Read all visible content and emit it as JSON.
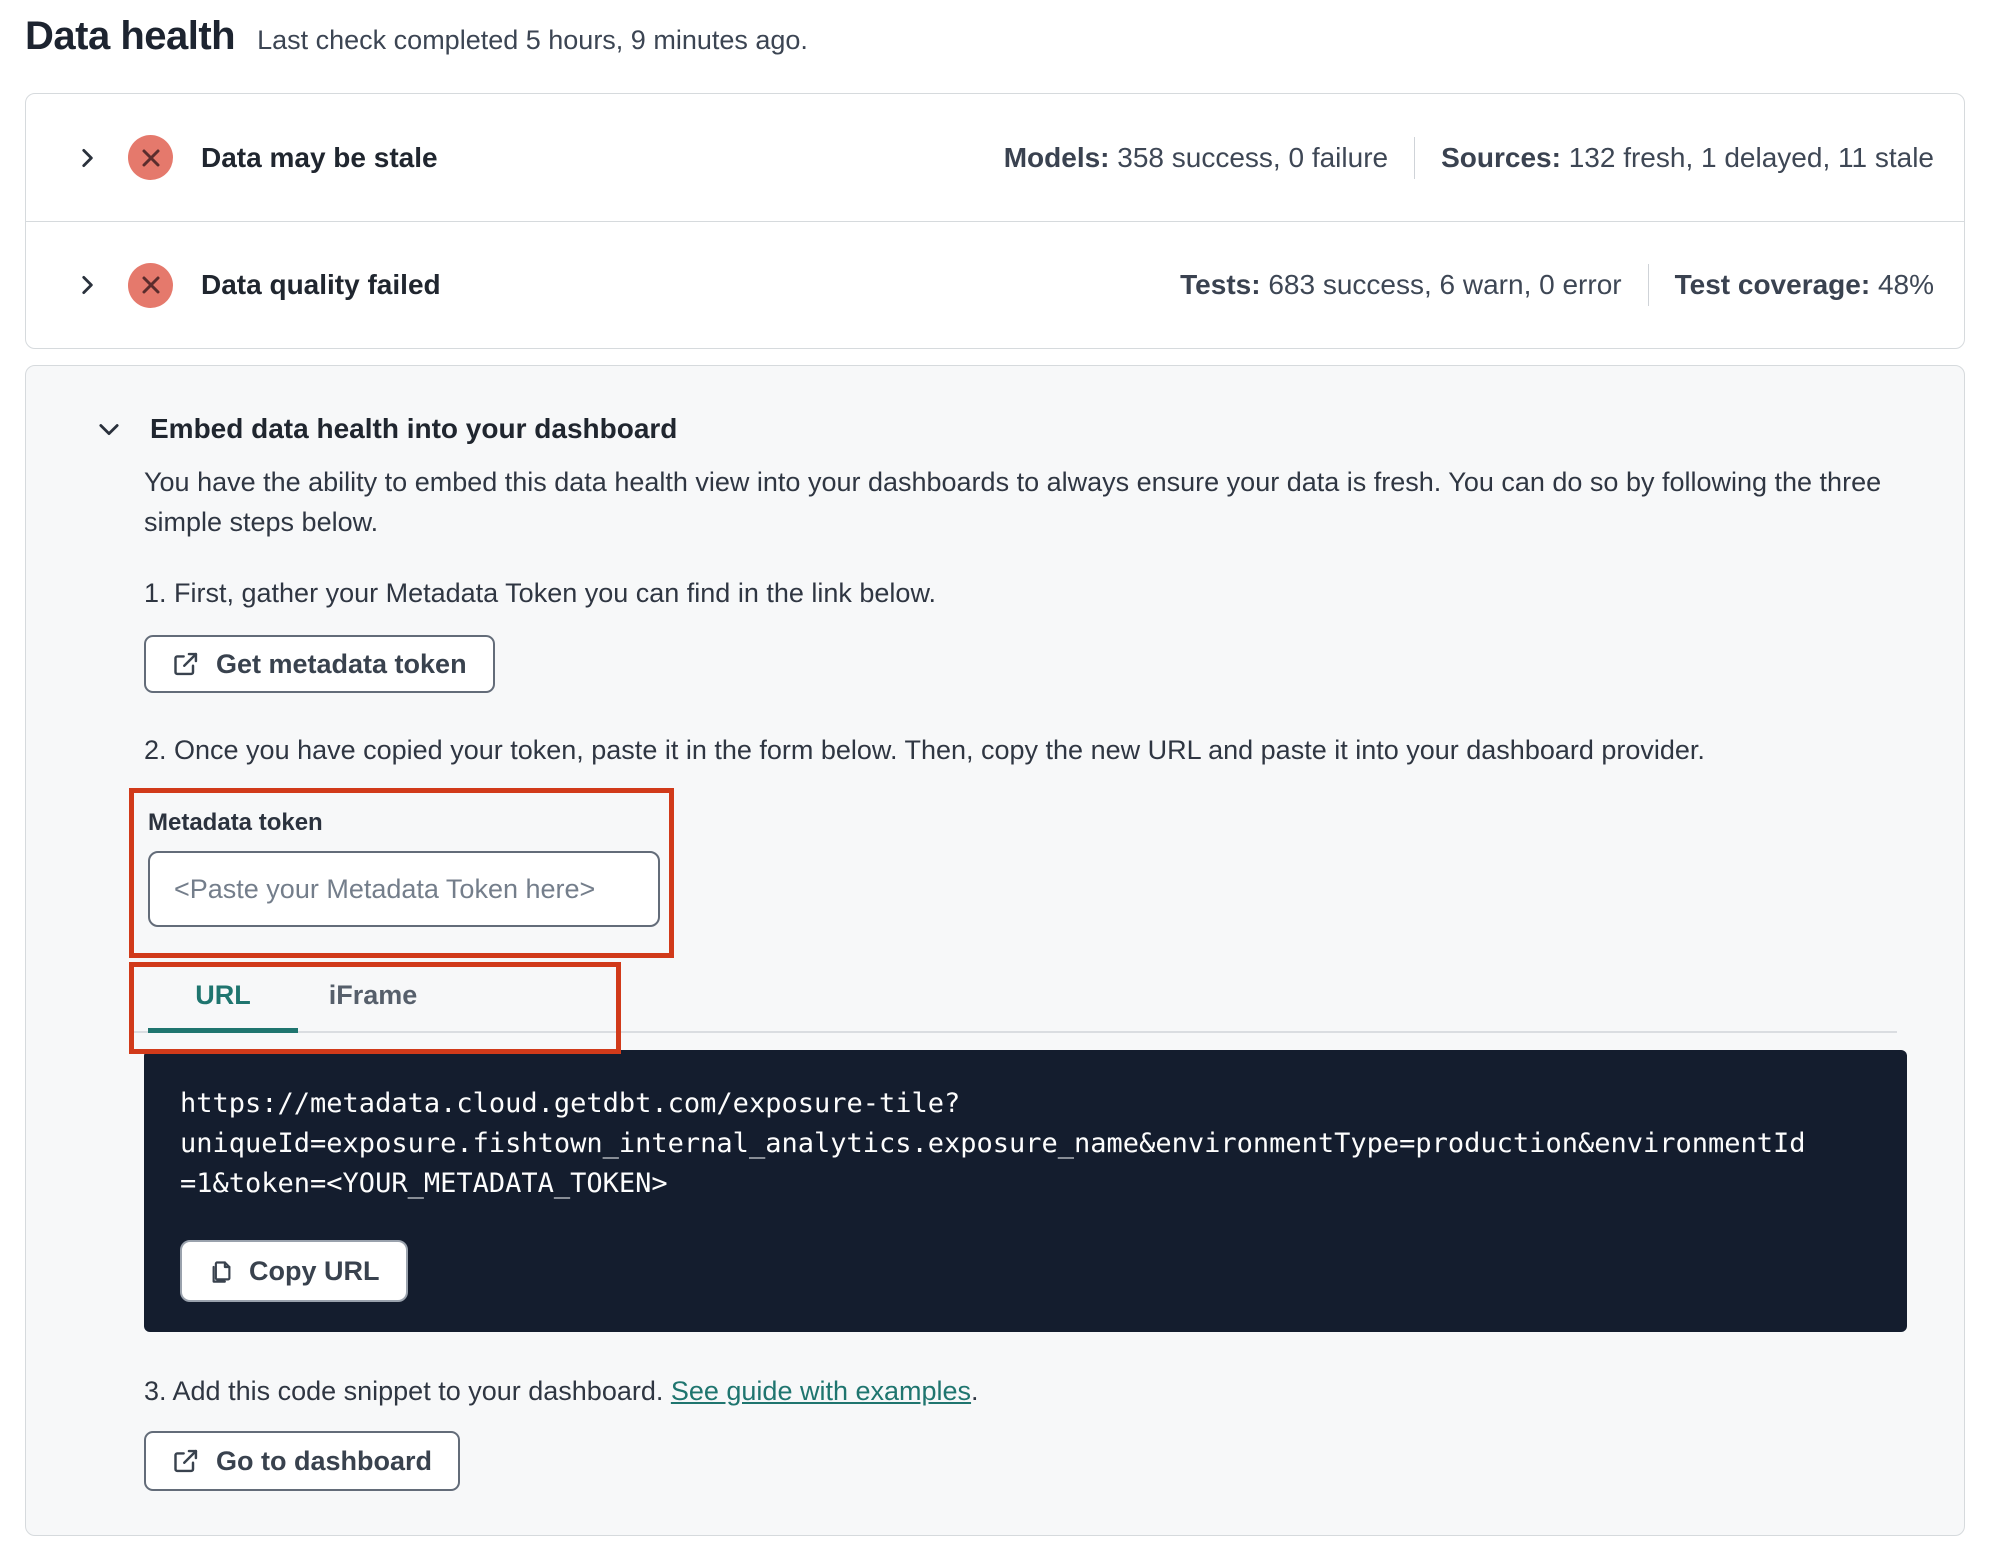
{
  "page": {
    "title": "Data health",
    "subtitle": "Last check completed 5 hours, 9 minutes ago."
  },
  "status_rows": [
    {
      "title": "Data may be stale",
      "stats": [
        {
          "label": "Models:",
          "value": "358 success, 0 failure"
        },
        {
          "label": "Sources:",
          "value": "132 fresh, 1 delayed, 11 stale"
        }
      ]
    },
    {
      "title": "Data quality failed",
      "stats": [
        {
          "label": "Tests:",
          "value": "683 success, 6 warn, 0 error"
        },
        {
          "label": "Test coverage:",
          "value": "48%"
        }
      ]
    }
  ],
  "embed": {
    "title": "Embed data health into your dashboard",
    "description": "You have the ability to embed this data health view into your dashboards to always ensure your data is fresh. You can do so by following the three simple steps below.",
    "step1": {
      "text": "1. First, gather your Metadata Token you can find in the link below.",
      "button_label": "Get metadata token"
    },
    "step2": {
      "text": "2. Once you have copied your token, paste it in the form below. Then, copy the new URL and paste it into your dashboard provider.",
      "token_label": "Metadata token",
      "token_placeholder": "<Paste your Metadata Token here>",
      "token_value": "",
      "tabs": [
        {
          "label": "URL"
        },
        {
          "label": "iFrame"
        }
      ],
      "active_tab": "URL",
      "code_lines": [
        "https://metadata.cloud.getdbt.com/exposure-tile?",
        "uniqueId=exposure.fishtown_internal_analytics.exposure_name&environmentType=production&environmentId",
        "=1&token=<YOUR_METADATA_TOKEN>"
      ],
      "copy_button_label": "Copy URL"
    },
    "step3": {
      "text_before_link": "3. Add this code snippet to your dashboard. ",
      "link_label": "See guide with examples",
      "text_after_link": ".",
      "button_label": "Go to dashboard"
    }
  },
  "icons": {
    "row_expand": "chevron-right-icon",
    "section_collapse": "chevron-down-icon",
    "status": "error-x-circle-icon",
    "external": "external-link-icon",
    "copy": "copy-icon"
  },
  "colors": {
    "accent_teal": "#1f756f",
    "annotation_red": "#d13a1a",
    "error_icon_bg": "#e5796c",
    "error_icon_glyph": "#5a2d2d",
    "code_block_bg": "#141d2e",
    "panel_bg": "#f7f8f9",
    "border_gray": "#d6dadd"
  }
}
